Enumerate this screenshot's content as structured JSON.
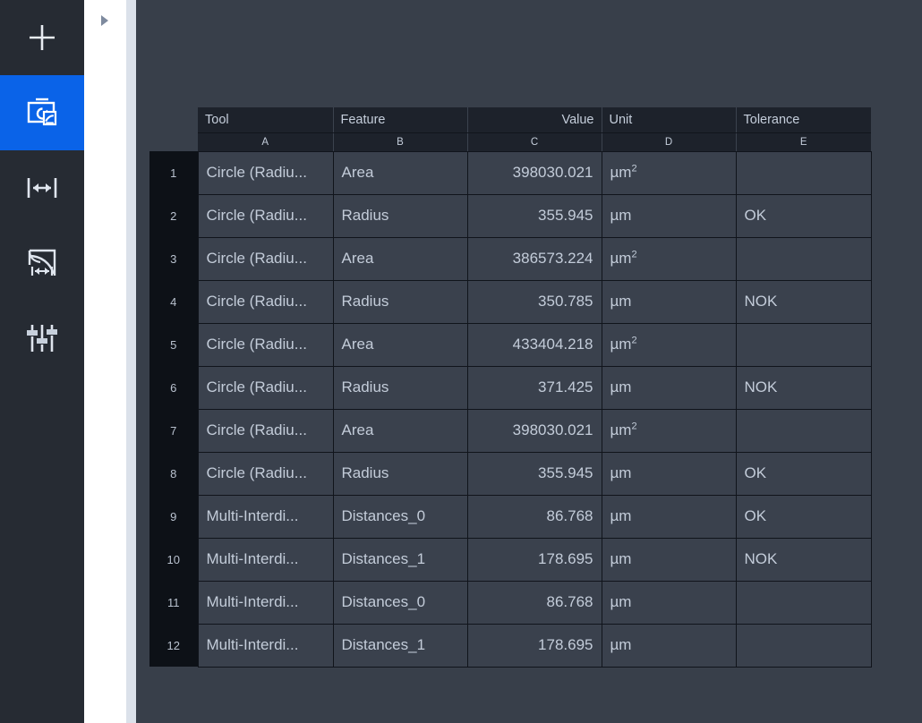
{
  "sidebar": {
    "items": [
      {
        "icon": "plus-icon",
        "name": "add-tool",
        "active": false
      },
      {
        "icon": "inspection-image-icon",
        "name": "measurement-results",
        "active": true
      },
      {
        "icon": "distance-measure-icon",
        "name": "distance-tool",
        "active": false
      },
      {
        "icon": "area-distance-icon",
        "name": "area-distance-tool",
        "active": false
      },
      {
        "icon": "sliders-icon",
        "name": "settings-tool",
        "active": false
      }
    ]
  },
  "panel": {
    "expand_icon": "triangle-right-icon"
  },
  "table": {
    "field_headers": [
      {
        "label": "Tool",
        "align": "left"
      },
      {
        "label": "Feature",
        "align": "left"
      },
      {
        "label": "Value",
        "align": "right"
      },
      {
        "label": "Unit",
        "align": "left"
      },
      {
        "label": "Tolerance",
        "align": "left"
      }
    ],
    "column_letters": [
      "A",
      "B",
      "C",
      "D",
      "E"
    ],
    "rows": [
      {
        "n": "1",
        "tool": "Circle (Radiu...",
        "feature": "Area",
        "value": "398030.021",
        "unit": "µm",
        "unit_sup": "2",
        "tolerance": ""
      },
      {
        "n": "2",
        "tool": "Circle (Radiu...",
        "feature": "Radius",
        "value": "355.945",
        "unit": "µm",
        "unit_sup": "",
        "tolerance": "OK"
      },
      {
        "n": "3",
        "tool": "Circle (Radiu...",
        "feature": "Area",
        "value": "386573.224",
        "unit": "µm",
        "unit_sup": "2",
        "tolerance": ""
      },
      {
        "n": "4",
        "tool": "Circle (Radiu...",
        "feature": "Radius",
        "value": "350.785",
        "unit": "µm",
        "unit_sup": "",
        "tolerance": "NOK"
      },
      {
        "n": "5",
        "tool": "Circle (Radiu...",
        "feature": "Area",
        "value": "433404.218",
        "unit": "µm",
        "unit_sup": "2",
        "tolerance": ""
      },
      {
        "n": "6",
        "tool": "Circle (Radiu...",
        "feature": "Radius",
        "value": "371.425",
        "unit": "µm",
        "unit_sup": "",
        "tolerance": "NOK"
      },
      {
        "n": "7",
        "tool": "Circle (Radiu...",
        "feature": "Area",
        "value": "398030.021",
        "unit": "µm",
        "unit_sup": "2",
        "tolerance": ""
      },
      {
        "n": "8",
        "tool": "Circle (Radiu...",
        "feature": "Radius",
        "value": "355.945",
        "unit": "µm",
        "unit_sup": "",
        "tolerance": "OK"
      },
      {
        "n": "9",
        "tool": "Multi-Interdi...",
        "feature": "Distances_0",
        "value": "86.768",
        "unit": "µm",
        "unit_sup": "",
        "tolerance": "OK"
      },
      {
        "n": "10",
        "tool": "Multi-Interdi...",
        "feature": "Distances_1",
        "value": "178.695",
        "unit": "µm",
        "unit_sup": "",
        "tolerance": "NOK"
      },
      {
        "n": "11",
        "tool": "Multi-Interdi...",
        "feature": "Distances_0",
        "value": "86.768",
        "unit": "µm",
        "unit_sup": "",
        "tolerance": ""
      },
      {
        "n": "12",
        "tool": "Multi-Interdi...",
        "feature": "Distances_1",
        "value": "178.695",
        "unit": "µm",
        "unit_sup": "",
        "tolerance": ""
      }
    ]
  },
  "colors": {
    "accent": "#0a63e8",
    "canvas_bg": "#383f4a",
    "rail_bg": "#262b33",
    "header_bg": "#1d222b",
    "cell_bg": "#3a414d",
    "rowhdr_bg": "#0d1117",
    "text": "#c3ccd9",
    "panel_bg": "#ffffff",
    "panel_edge": "#dbe1ea"
  }
}
